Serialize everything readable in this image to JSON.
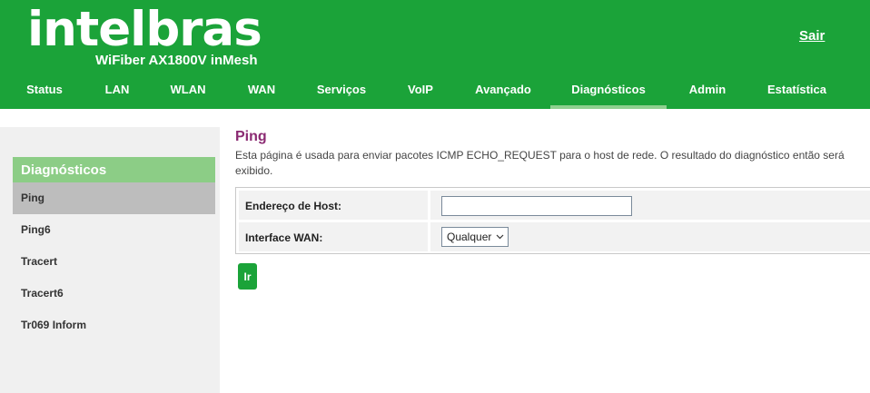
{
  "brand": {
    "logo_text": "intelbras",
    "model": "WiFiber AX1800V inMesh",
    "logout_label": "Sair"
  },
  "nav": {
    "items": [
      {
        "label": "Status"
      },
      {
        "label": "LAN"
      },
      {
        "label": "WLAN"
      },
      {
        "label": "WAN"
      },
      {
        "label": "Serviços"
      },
      {
        "label": "VoIP"
      },
      {
        "label": "Avançado"
      },
      {
        "label": "Diagnósticos"
      },
      {
        "label": "Admin"
      },
      {
        "label": "Estatística"
      }
    ],
    "active": "Diagnósticos"
  },
  "sidebar": {
    "title": "Diagnósticos",
    "items": [
      {
        "label": "Ping"
      },
      {
        "label": "Ping6"
      },
      {
        "label": "Tracert"
      },
      {
        "label": "Tracert6"
      },
      {
        "label": "Tr069 Inform"
      }
    ],
    "active": "Ping"
  },
  "main": {
    "title": "Ping",
    "description": "Esta página é usada para enviar pacotes ICMP ECHO_REQUEST para o host de rede. O resultado do diagnóstico então será exibido.",
    "form": {
      "host_label": "Endereço de Host:",
      "host_value": "",
      "wan_label": "Interface WAN:",
      "wan_selected": "Qualquer"
    },
    "go_label": "Ir"
  },
  "colors": {
    "brand_green": "#1ba339",
    "sidebar_header": "#8ccd86",
    "title_purple": "#8b2a72"
  }
}
